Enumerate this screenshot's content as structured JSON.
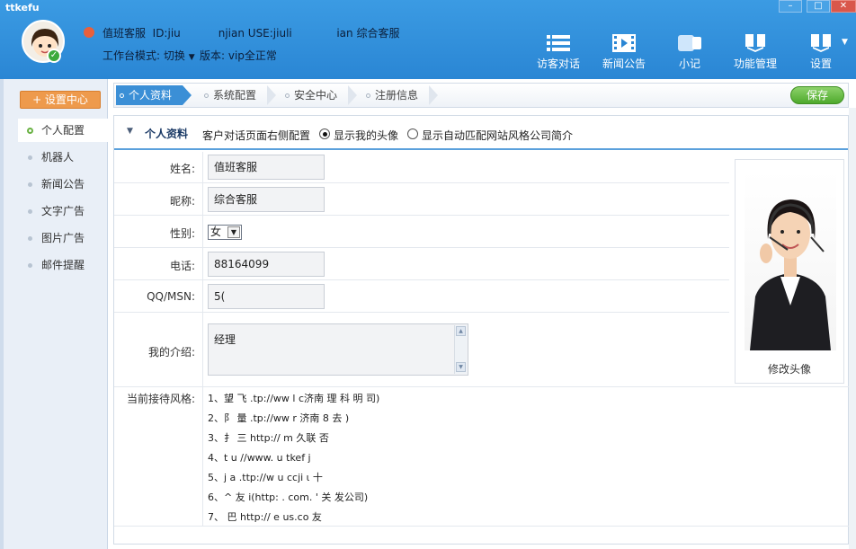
{
  "window": {
    "title": "ttkefu",
    "controls": [
      "–",
      "□",
      "✕"
    ]
  },
  "header": {
    "user_line": [
      "值班客服",
      "ID:jiu",
      "njian USE:jiuli",
      "ian 综合客服"
    ],
    "mode_label": "工作台模式: 切换",
    "version_label": "版本: vip全正常",
    "nav": [
      {
        "label": "访客对话",
        "icon": "list-icon"
      },
      {
        "label": "新闻公告",
        "icon": "film-icon"
      },
      {
        "label": "小记",
        "icon": "note-icon"
      },
      {
        "label": "功能管理",
        "icon": "function-icon"
      },
      {
        "label": "设置",
        "icon": "settings-icon"
      }
    ]
  },
  "sidebar": {
    "settings_button": "+ 设置中心",
    "items": [
      {
        "label": "个人配置",
        "active": true
      },
      {
        "label": "机器人"
      },
      {
        "label": "新闻公告"
      },
      {
        "label": "文字广告"
      },
      {
        "label": "图片广告"
      },
      {
        "label": "邮件提醒"
      }
    ]
  },
  "tabs": [
    {
      "label": "个人资料",
      "active": true
    },
    {
      "label": "系统配置"
    },
    {
      "label": "安全中心"
    },
    {
      "label": "注册信息"
    }
  ],
  "save_button": "保存",
  "panel": {
    "title": "个人资料",
    "config_text": "客户对话页面右侧配置",
    "radio_options": [
      {
        "label": "显示我的头像",
        "checked": true
      },
      {
        "label": "显示自动匹配网站风格公司简介",
        "checked": false
      }
    ]
  },
  "form": {
    "name_label": "姓名:",
    "name_value": "值班客服",
    "nick_label": "昵称:",
    "nick_value": "综合客服",
    "gender_label": "性别:",
    "gender_value": "女",
    "phone_label": "电话:",
    "phone_value": "88164099",
    "qq_label": "QQ/MSN:",
    "qq_value": "5(",
    "intro_label": "我的介绍:",
    "intro_value": "经理",
    "style_label": "当前接待风格:",
    "styles": [
      "1、望  飞  .tp://ww     l    c济南  理  科  明 司)",
      "2、阝    量  .tp://ww     r   济南     8   去         )",
      "3、扌    三   http://        m 久联    否",
      "4、t     u   //www.       u    tkef    j",
      "5、j     a  .ttp://w      u    ccji    ι  十",
      "6、^     友    i(http:     .     com.    '  关           发公司)",
      "7、       巴  http://     e    us.co    友"
    ]
  },
  "photo": {
    "label": "修改头像"
  },
  "colors": {
    "header": "#2a86d4",
    "accent": "#3b8fd6",
    "save": "#4ea92c",
    "settings": "#ee9a4c"
  }
}
